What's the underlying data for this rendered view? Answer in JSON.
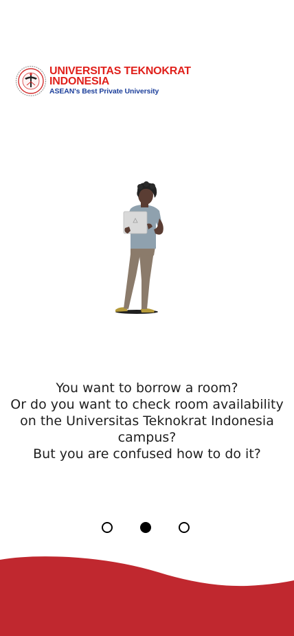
{
  "logo": {
    "line1": "UNIVERSITAS TEKNOKRAT",
    "line2": "INDONESIA",
    "tagline": "ASEAN's Best Private University"
  },
  "onboarding": {
    "lines": [
      "You want to borrow a room?",
      "Or do you want to check room availability",
      "on the Universitas Teknokrat Indonesia",
      "campus?",
      "But you are confused how to do it?"
    ],
    "current_page": 2,
    "total_pages": 3
  },
  "colors": {
    "brand_red": "#e0201b",
    "brand_blue": "#1c3f9b",
    "wave_red": "#c0282f"
  }
}
